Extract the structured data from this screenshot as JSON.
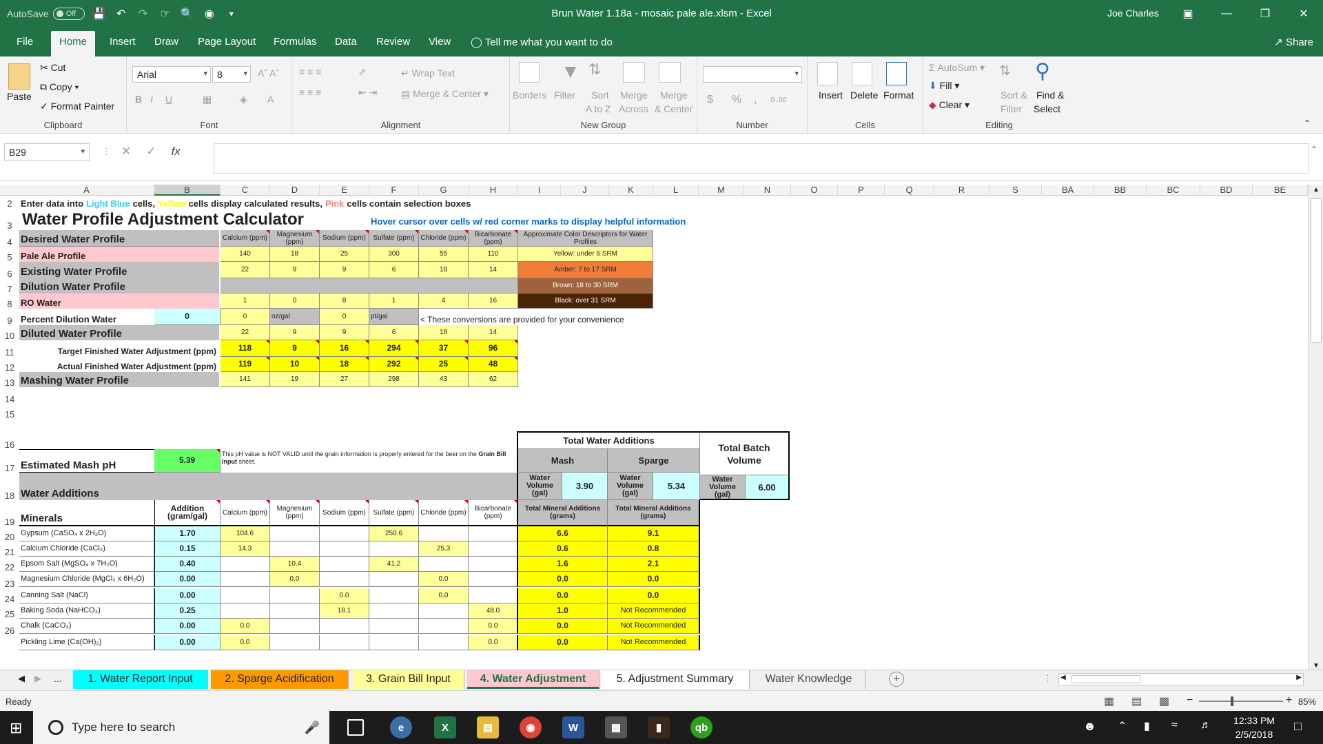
{
  "titlebar": {
    "autosave": "AutoSave",
    "autosave_state": "Off",
    "title": "Brun Water 1.18a - mosaic pale ale.xlsm  -  Excel",
    "user": "Joe Charles"
  },
  "tabs": [
    "File",
    "Home",
    "Insert",
    "Draw",
    "Page Layout",
    "Formulas",
    "Data",
    "Review",
    "View"
  ],
  "tell_me": "Tell me what you want to do",
  "share": "Share",
  "ribbon": {
    "clipboard": {
      "paste": "Paste",
      "cut": "Cut",
      "copy": "Copy",
      "format_painter": "Format Painter",
      "label": "Clipboard"
    },
    "font": {
      "name": "Arial",
      "size": "8",
      "label": "Font"
    },
    "alignment": {
      "wrap": "Wrap Text",
      "merge": "Merge & Center",
      "label": "Alignment"
    },
    "newgroup": {
      "borders": "Borders",
      "filter": "Filter",
      "sort1": "Sort",
      "sort2": "A to Z",
      "merge_across1": "Merge",
      "merge_across2": "Across",
      "merge_center1": "Merge",
      "merge_center2": "& Center",
      "label": "New Group"
    },
    "number": {
      "dollar": "$",
      "percent": "%",
      "comma": ",",
      "label": "Number"
    },
    "cells": {
      "insert": "Insert",
      "delete": "Delete",
      "format": "Format",
      "label": "Cells"
    },
    "editing": {
      "autosum": "AutoSum",
      "fill": "Fill",
      "clear": "Clear",
      "sort_filter1": "Sort &",
      "sort_filter2": "Filter",
      "find_select1": "Find &",
      "find_select2": "Select",
      "label": "Editing"
    }
  },
  "formula_bar": {
    "name_box": "B29",
    "fx": "fx",
    "formula": ""
  },
  "columns": [
    "A",
    "B",
    "C",
    "D",
    "E",
    "F",
    "G",
    "H",
    "I",
    "J",
    "K",
    "L",
    "M",
    "N",
    "O",
    "P",
    "Q",
    "R",
    "S",
    "BA",
    "BB",
    "BC",
    "BD",
    "BE"
  ],
  "rows": [
    "2",
    "3",
    "4",
    "5",
    "6",
    "7",
    "8",
    "9",
    "10",
    "11",
    "12",
    "13",
    "14",
    "15",
    "16",
    "17",
    "18",
    "19",
    "20",
    "21",
    "22",
    "23",
    "24",
    "25",
    "26"
  ],
  "sheet": {
    "intro_1": "Enter data into",
    "intro_lb": "Light Blue",
    "intro_2": "cells,",
    "intro_y": "Yellow",
    "intro_3": "cells display calculated results,",
    "intro_p": "Pink",
    "intro_4": "cells contain selection boxes",
    "title": "Water Profile Adjustment Calculator",
    "hover": "Hover cursor over cells w/ red corner marks to display helpful information",
    "ion_headers": [
      "Calcium (ppm)",
      "Magnesium (ppm)",
      "Sodium (ppm)",
      "Sulfate (ppm)",
      "Chloride (ppm)",
      "Bicarbonate (ppm)"
    ],
    "color_desc_header": "Approximate Color Descriptors for Water Profiles",
    "color_desc": [
      "Yellow: under 6 SRM",
      "Amber: 7 to 17 SRM",
      "Brown: 18 to 30 SRM",
      "Black: over 31 SRM"
    ],
    "desired": "Desired Water Profile",
    "pale_ale": "Pale Ale Profile",
    "pale_ale_vals": [
      "140",
      "18",
      "25",
      "300",
      "55",
      "110"
    ],
    "existing": "Existing Water Profile",
    "existing_vals": [
      "22",
      "9",
      "9",
      "6",
      "18",
      "14"
    ],
    "dilution": "Dilution Water Profile",
    "ro": "RO Water",
    "ro_vals": [
      "1",
      "0",
      "8",
      "1",
      "4",
      "16"
    ],
    "pct_dilution": "Percent Dilution Water",
    "pct_dilution_val": "0",
    "conv_vals": [
      "0",
      "oz/gal",
      "0",
      "pt/gal"
    ],
    "conv_note": "< These conversions are provided for your convenience",
    "diluted": "Diluted Water Profile",
    "diluted_vals": [
      "22",
      "9",
      "9",
      "6",
      "18",
      "14"
    ],
    "target": "Target Finished Water Adjustment (ppm)",
    "target_vals": [
      "118",
      "9",
      "16",
      "294",
      "37",
      "96"
    ],
    "actual": "Actual Finished Water Adjustment (ppm)",
    "actual_vals": [
      "119",
      "10",
      "18",
      "292",
      "25",
      "48"
    ],
    "mashing": "Mashing Water Profile",
    "mashing_vals": [
      "141",
      "19",
      "27",
      "298",
      "43",
      "62"
    ],
    "total_additions": "Total Water Additions",
    "total_batch": "Total Batch Volume",
    "est_ph": "Estimated Mash pH",
    "ph_val": "5.39",
    "ph_note_1": "This pH value is NOT VALID until the grain information is properly entered for the beer on the",
    "ph_note_2": "Grain Bill Input",
    "ph_note_3": "sheet.",
    "mash": "Mash",
    "sparge": "Sparge",
    "water_volume": "Water Volume (gal)",
    "mash_vol": "3.90",
    "sparge_vol": "5.34",
    "batch_vol": "6.00",
    "water_additions": "Water Additions",
    "minerals": "Minerals",
    "addition_hdr": "Addition (gram/gal)",
    "total_mineral": "Total Mineral Additions (grams)",
    "mineral_rows": [
      {
        "name": "Gypsum (CaSO₄ x 2H₂O)",
        "add": "1.70",
        "ions": [
          "104.6",
          "",
          "",
          "250.6",
          "",
          ""
        ],
        "mash": "6.6",
        "sparge": "9.1"
      },
      {
        "name": "Calcium Chloride (CaCl₂)",
        "add": "0.15",
        "ions": [
          "14.3",
          "",
          "",
          "",
          "25.3",
          ""
        ],
        "mash": "0.6",
        "sparge": "0.8"
      },
      {
        "name": "Epsom Salt (MgSO₄ x 7H₂O)",
        "add": "0.40",
        "ions": [
          "",
          "10.4",
          "",
          "41.2",
          "",
          ""
        ],
        "mash": "1.6",
        "sparge": "2.1"
      },
      {
        "name": "Magnesium Chloride (MgCl₂ x 6H₂O)",
        "add": "0.00",
        "ions": [
          "",
          "0.0",
          "",
          "",
          "0.0",
          ""
        ],
        "mash": "0.0",
        "sparge": "0.0"
      },
      {
        "name": "Canning Salt (NaCl)",
        "add": "0.00",
        "ions": [
          "",
          "",
          "0.0",
          "",
          "0.0",
          ""
        ],
        "mash": "0.0",
        "sparge": "0.0"
      },
      {
        "name": "Baking Soda (NaHCO₃)",
        "add": "0.25",
        "ions": [
          "",
          "",
          "18.1",
          "",
          "",
          "48.0"
        ],
        "mash": "1.0",
        "sparge": "Not Recommended"
      },
      {
        "name": "Chalk (CaCO₃)",
        "add": "0.00",
        "ions": [
          "0.0",
          "",
          "",
          "",
          "",
          "0.0"
        ],
        "mash": "0.0",
        "sparge": "Not Recommended"
      },
      {
        "name": "Pickling Lime (Ca(OH)₂)",
        "add": "0.00",
        "ions": [
          "0.0",
          "",
          "",
          "",
          "",
          "0.0"
        ],
        "mash": "0.0",
        "sparge": "Not Recommended"
      }
    ]
  },
  "sheet_tabs": [
    "1. Water Report Input",
    "2. Sparge Acidification",
    "3. Grain Bill Input",
    "4. Water Adjustment",
    "5. Adjustment Summary",
    "Water Knowledge"
  ],
  "status": {
    "ready": "Ready",
    "zoom": "85%"
  },
  "taskbar": {
    "search": "Type here to search",
    "time": "12:33 PM",
    "date": "2/5/2018"
  }
}
